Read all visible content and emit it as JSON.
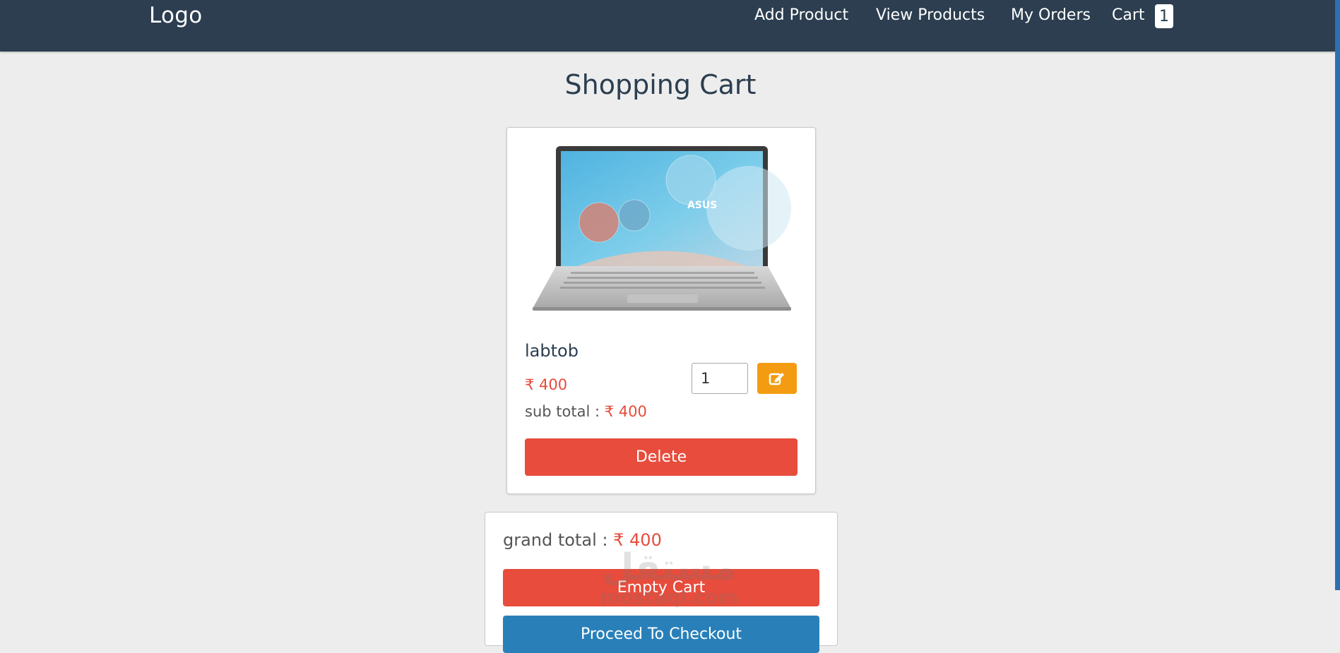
{
  "header": {
    "logo": "Logo",
    "nav": {
      "add_product": "Add Product",
      "view_products": "View Products",
      "my_orders": "My Orders",
      "cart": "Cart",
      "cart_count": "1"
    }
  },
  "page": {
    "title": "Shopping Cart"
  },
  "cart_item": {
    "name": "labtob",
    "price": "₹ 400",
    "subtotal_label": "sub total :",
    "subtotal_value": "₹ 400",
    "quantity": "1",
    "delete_label": "Delete",
    "edit_icon": "edit-icon",
    "image_icon": "laptop-image",
    "image_brand_text": "ASUS"
  },
  "totals": {
    "grand_total_label": "grand total :",
    "grand_total_value": "₹ 400",
    "empty_cart_label": "Empty Cart",
    "checkout_label": "Proceed To Checkout"
  },
  "watermark": {
    "arabic": "مستقل",
    "latin": "mostaql.com"
  },
  "colors": {
    "header": "#2c3e50",
    "danger": "#e74c3c",
    "warning": "#f39c12",
    "primary": "#2980b9",
    "background": "#ededed"
  }
}
